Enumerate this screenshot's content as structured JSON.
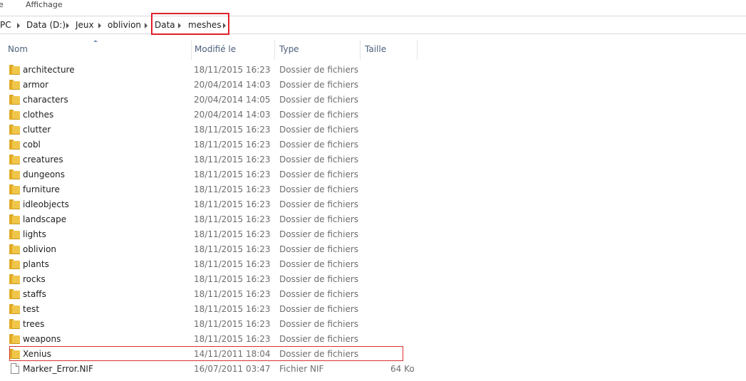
{
  "menu": {
    "items": [
      "e",
      "Affichage"
    ]
  },
  "breadcrumb": {
    "segments": [
      "PC",
      "Data (D:)",
      "Jeux",
      "oblivion",
      "Data",
      "meshes"
    ]
  },
  "columns": {
    "name": "Nom",
    "modified": "Modifié le",
    "type": "Type",
    "size": "Taille"
  },
  "rows": [
    {
      "name": "architecture",
      "modified": "18/11/2015 16:23",
      "type": "Dossier de fichiers",
      "size": "",
      "icon": "folder-icon"
    },
    {
      "name": "armor",
      "modified": "20/04/2014 14:03",
      "type": "Dossier de fichiers",
      "size": "",
      "icon": "folder-icon"
    },
    {
      "name": "characters",
      "modified": "20/04/2014 14:05",
      "type": "Dossier de fichiers",
      "size": "",
      "icon": "folder-icon"
    },
    {
      "name": "clothes",
      "modified": "20/04/2014 14:03",
      "type": "Dossier de fichiers",
      "size": "",
      "icon": "folder-icon"
    },
    {
      "name": "clutter",
      "modified": "18/11/2015 16:23",
      "type": "Dossier de fichiers",
      "size": "",
      "icon": "folder-icon"
    },
    {
      "name": "cobl",
      "modified": "18/11/2015 16:23",
      "type": "Dossier de fichiers",
      "size": "",
      "icon": "folder-icon"
    },
    {
      "name": "creatures",
      "modified": "18/11/2015 16:23",
      "type": "Dossier de fichiers",
      "size": "",
      "icon": "folder-icon"
    },
    {
      "name": "dungeons",
      "modified": "18/11/2015 16:23",
      "type": "Dossier de fichiers",
      "size": "",
      "icon": "folder-icon"
    },
    {
      "name": "furniture",
      "modified": "18/11/2015 16:23",
      "type": "Dossier de fichiers",
      "size": "",
      "icon": "folder-icon"
    },
    {
      "name": "idleobjects",
      "modified": "18/11/2015 16:23",
      "type": "Dossier de fichiers",
      "size": "",
      "icon": "folder-icon"
    },
    {
      "name": "landscape",
      "modified": "18/11/2015 16:23",
      "type": "Dossier de fichiers",
      "size": "",
      "icon": "folder-icon"
    },
    {
      "name": "lights",
      "modified": "18/11/2015 16:23",
      "type": "Dossier de fichiers",
      "size": "",
      "icon": "folder-icon"
    },
    {
      "name": "oblivion",
      "modified": "18/11/2015 16:23",
      "type": "Dossier de fichiers",
      "size": "",
      "icon": "folder-icon"
    },
    {
      "name": "plants",
      "modified": "18/11/2015 16:23",
      "type": "Dossier de fichiers",
      "size": "",
      "icon": "folder-icon"
    },
    {
      "name": "rocks",
      "modified": "18/11/2015 16:23",
      "type": "Dossier de fichiers",
      "size": "",
      "icon": "folder-icon"
    },
    {
      "name": "staffs",
      "modified": "18/11/2015 16:23",
      "type": "Dossier de fichiers",
      "size": "",
      "icon": "folder-icon"
    },
    {
      "name": "test",
      "modified": "18/11/2015 16:23",
      "type": "Dossier de fichiers",
      "size": "",
      "icon": "folder-icon"
    },
    {
      "name": "trees",
      "modified": "18/11/2015 16:23",
      "type": "Dossier de fichiers",
      "size": "",
      "icon": "folder-icon"
    },
    {
      "name": "weapons",
      "modified": "18/11/2015 16:23",
      "type": "Dossier de fichiers",
      "size": "",
      "icon": "folder-icon"
    },
    {
      "name": "Xenius",
      "modified": "14/11/2011 18:04",
      "type": "Dossier de fichiers",
      "size": "",
      "icon": "folder-icon"
    },
    {
      "name": "Marker_Error.NIF",
      "modified": "16/07/2011 03:47",
      "type": "Fichier NIF",
      "size": "64 Ko",
      "icon": "file-icon"
    }
  ],
  "colors": {
    "annotation_red": "#e0202a",
    "header_text": "#4c607a",
    "folder_yellow": "#f0c64a"
  }
}
